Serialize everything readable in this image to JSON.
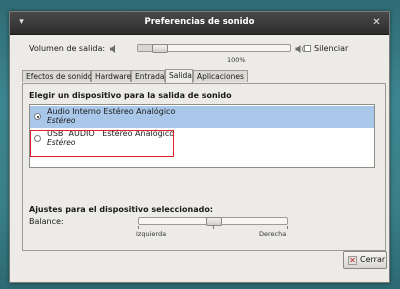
{
  "window": {
    "title": "Preferencias de sonido",
    "menu_icon": "window-menu-icon",
    "close_icon": "close-icon"
  },
  "volume": {
    "label": "Volumen de salida:",
    "value_percent": 100,
    "percent_label": "100%",
    "mute_label": "Silenciar",
    "muted": false
  },
  "tabs": [
    {
      "label": "Efectos de sonido",
      "active": false
    },
    {
      "label": "Hardware",
      "active": false
    },
    {
      "label": "Entrada",
      "active": false
    },
    {
      "label": "Salida",
      "active": true
    },
    {
      "label": "Aplicaciones",
      "active": false
    }
  ],
  "output": {
    "section_title": "Elegir un dispositivo para la salida de sonido",
    "devices": [
      {
        "name": "Audio Interno Estéreo Analógico",
        "profile": "Estéreo",
        "selected": true
      },
      {
        "name": "USB  AUDIO   Estéreo Analógico",
        "profile": "Estéreo",
        "selected": false
      }
    ]
  },
  "balance": {
    "section_title": "Ajustes para el dispositivo seleccionado:",
    "label": "Balance:",
    "left_label": "Izquierda",
    "right_label": "Derecha",
    "value": 0
  },
  "footer": {
    "close_label": "Cerrar"
  },
  "colors": {
    "selection": "#a9c7e8",
    "highlight_box": "#e0222a",
    "titlebar": "#2c2c2c"
  }
}
